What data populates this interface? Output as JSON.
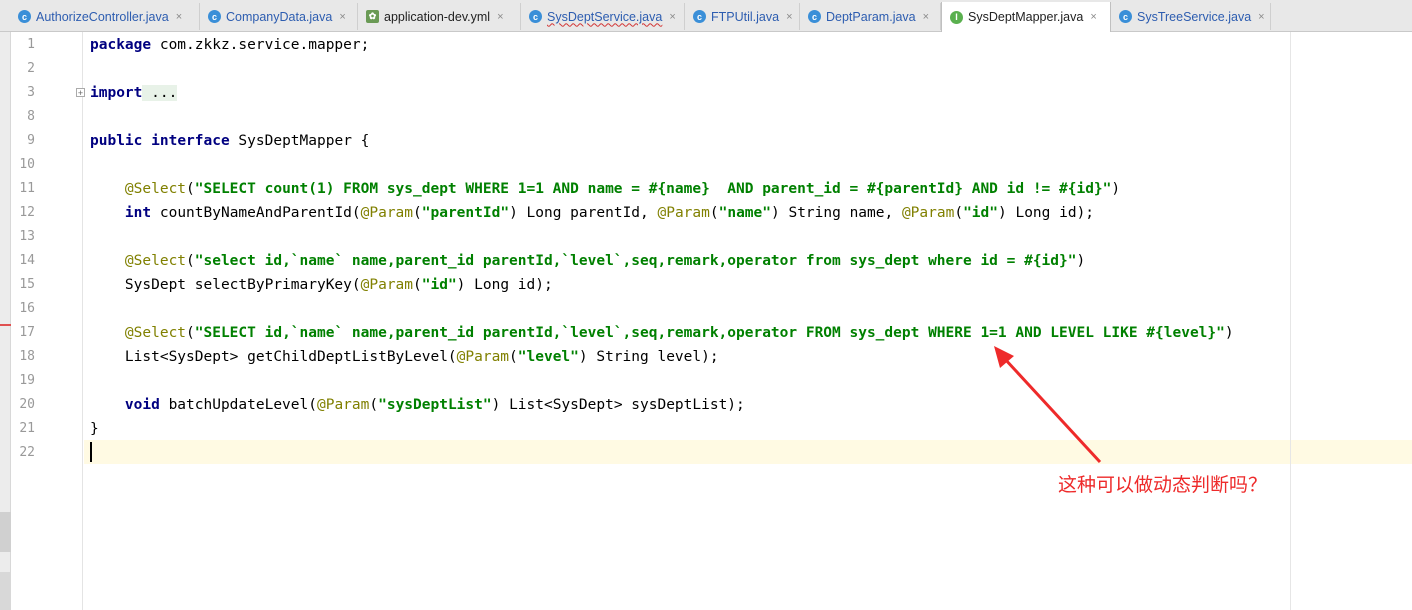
{
  "tabs": [
    {
      "label": "AuthorizeController.java",
      "icon": "class-icon",
      "active": false
    },
    {
      "label": "CompanyData.java",
      "icon": "class-icon",
      "active": false
    },
    {
      "label": "application-dev.yml",
      "icon": "yml-file-icon",
      "active": false
    },
    {
      "label": "SysDeptService.java",
      "icon": "class-icon",
      "active": false
    },
    {
      "label": "FTPUtil.java",
      "icon": "class-icon",
      "active": false
    },
    {
      "label": "DeptParam.java",
      "icon": "class-icon",
      "active": false
    },
    {
      "label": "SysDeptMapper.java",
      "icon": "interface-icon",
      "active": true
    },
    {
      "label": "SysTreeService.java",
      "icon": "class-icon",
      "active": false
    }
  ],
  "tab_close": "×",
  "gutter": {
    "line_numbers": [
      "1",
      "2",
      "3",
      "8",
      "9",
      "10",
      "11",
      "12",
      "13",
      "14",
      "15",
      "16",
      "17",
      "18",
      "19",
      "20",
      "21",
      "22"
    ],
    "fold_marker": "+"
  },
  "code": {
    "l1_kw": "package",
    "l1_rest": " com.zkkz.service.mapper;",
    "l3_kw": "import",
    "l3_rest": " ...",
    "l9_kw1": "public",
    "l9_kw2": "interface",
    "l9_rest": " SysDeptMapper {",
    "l11_ann": "@Select",
    "l11_str": "\"SELECT count(1) FROM sys_dept WHERE 1=1 AND name = #{name}  AND parent_id = #{parentId} AND id != #{id}\"",
    "l12_kw": "int",
    "l12_a": " countByNameAndParentId(",
    "l12_ann1": "@Param",
    "l12_str1": "\"parentId\"",
    "l12_b": ") Long parentId, ",
    "l12_ann2": "@Param",
    "l12_str2": "\"name\"",
    "l12_c": ") String name, ",
    "l12_ann3": "@Param",
    "l12_str3": "\"id\"",
    "l12_d": ") Long id);",
    "l14_ann": "@Select",
    "l14_str": "\"select id,`name` name,parent_id parentId,`level`,seq,remark,operator from sys_dept where id = #{id}\"",
    "l15_a": "SysDept selectByPrimaryKey(",
    "l15_ann": "@Param",
    "l15_str": "\"id\"",
    "l15_b": ") Long id);",
    "l17_ann": "@Select",
    "l17_str": "\"SELECT id,`name` name,parent_id parentId,`level`,seq,remark,operator FROM sys_dept WHERE 1=1 AND LEVEL LIKE #{level}\"",
    "l18_a": "List<SysDept> getChildDeptListByLevel(",
    "l18_ann": "@Param",
    "l18_str": "\"level\"",
    "l18_b": ") String level);",
    "l20_kw": "void",
    "l20_a": " batchUpdateLevel(",
    "l20_ann": "@Param",
    "l20_str": "\"sysDeptList\"",
    "l20_b": ") List<SysDept> sysDeptList);",
    "l21": "}"
  },
  "annotation": {
    "text": "这种可以做动态判断吗？",
    "color": "#ee2a2a"
  },
  "colors": {
    "keyword": "#000080",
    "string": "#008000",
    "annotation": "#808000",
    "current_line": "#fffae3"
  }
}
